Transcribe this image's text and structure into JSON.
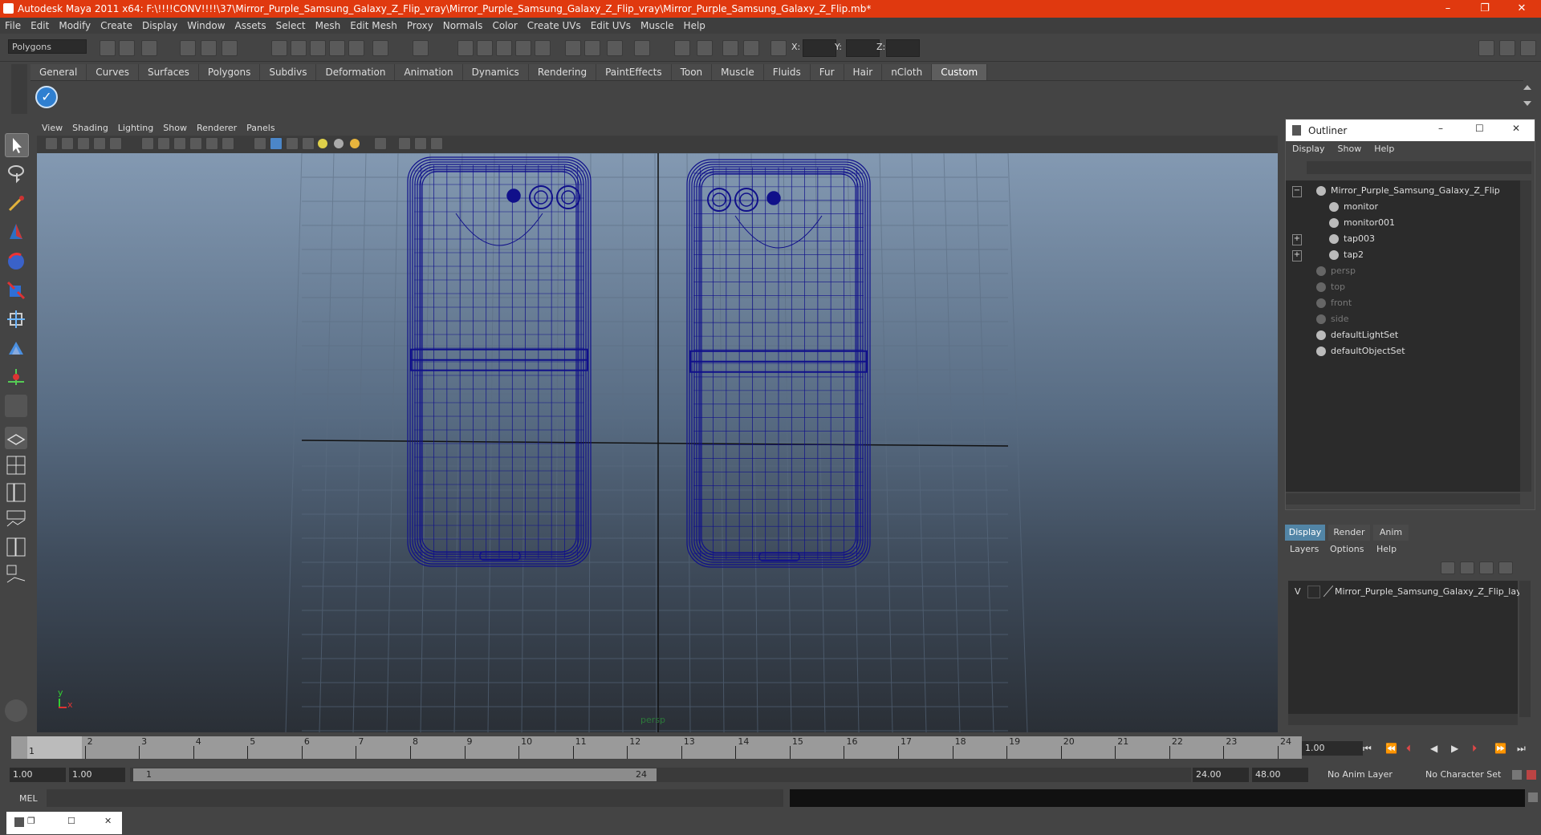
{
  "window": {
    "title": "Autodesk Maya 2011 x64: F:\\!!!!CONV!!!!\\37\\Mirror_Purple_Samsung_Galaxy_Z_Flip_vray\\Mirror_Purple_Samsung_Galaxy_Z_Flip_vray\\Mirror_Purple_Samsung_Galaxy_Z_Flip.mb*",
    "minimize": "–",
    "maximize": "❐",
    "close": "✕"
  },
  "menubar": [
    "File",
    "Edit",
    "Modify",
    "Create",
    "Display",
    "Window",
    "Assets",
    "Select",
    "Mesh",
    "Edit Mesh",
    "Proxy",
    "Normals",
    "Color",
    "Create UVs",
    "Edit UVs",
    "Muscle",
    "Help"
  ],
  "statusline": {
    "mode": "Polygons",
    "x_label": "X:",
    "y_label": "Y:",
    "z_label": "Z:"
  },
  "shelf_tabs": [
    "General",
    "Curves",
    "Surfaces",
    "Polygons",
    "Subdivs",
    "Deformation",
    "Animation",
    "Dynamics",
    "Rendering",
    "PaintEffects",
    "Toon",
    "Muscle",
    "Fluids",
    "Fur",
    "Hair",
    "nCloth",
    "Custom"
  ],
  "active_shelf_tab": "Custom",
  "viewport": {
    "menu": [
      "View",
      "Shading",
      "Lighting",
      "Show",
      "Renderer",
      "Panels"
    ],
    "camera_label": "persp",
    "axis_y": "y",
    "axis_x": "x"
  },
  "outliner": {
    "title": "Outliner",
    "menu": [
      "Display",
      "Show",
      "Help"
    ],
    "items": [
      {
        "label": "Mirror_Purple_Samsung_Galaxy_Z_Flip",
        "expander": "−",
        "dim": false
      },
      {
        "label": "monitor",
        "expander": "",
        "dim": false
      },
      {
        "label": "monitor001",
        "expander": "",
        "dim": false
      },
      {
        "label": "tap003",
        "expander": "+",
        "dim": false
      },
      {
        "label": "tap2",
        "expander": "+",
        "dim": false
      },
      {
        "label": "persp",
        "expander": "",
        "dim": true
      },
      {
        "label": "top",
        "expander": "",
        "dim": true
      },
      {
        "label": "front",
        "expander": "",
        "dim": true
      },
      {
        "label": "side",
        "expander": "",
        "dim": true
      },
      {
        "label": "defaultLightSet",
        "expander": "",
        "dim": false
      },
      {
        "label": "defaultObjectSet",
        "expander": "",
        "dim": false
      }
    ]
  },
  "layer_editor": {
    "tabs": [
      "Display",
      "Render",
      "Anim"
    ],
    "active_tab": "Display",
    "menu": [
      "Layers",
      "Options",
      "Help"
    ],
    "layer": {
      "visible": "V",
      "name": "Mirror_Purple_Samsung_Galaxy_Z_Flip_layer"
    }
  },
  "timeline": {
    "ticks": [
      "1",
      "2",
      "3",
      "4",
      "5",
      "6",
      "7",
      "8",
      "9",
      "10",
      "11",
      "12",
      "13",
      "14",
      "15",
      "16",
      "17",
      "18",
      "19",
      "20",
      "21",
      "22",
      "23",
      "24"
    ],
    "current_frame": "1.00",
    "current_marker": "1"
  },
  "range": {
    "start": "1.00",
    "anim_start": "1.00",
    "slider_start": "1",
    "slider_end": "24",
    "anim_end": "24.00",
    "end": "48.00",
    "anim_layer": "No Anim Layer",
    "character_set": "No Character Set"
  },
  "command": {
    "label": "MEL"
  },
  "colors": {
    "title_bar": "#e0390f",
    "wireframe": "#10108a",
    "accent": "#5285a6"
  }
}
